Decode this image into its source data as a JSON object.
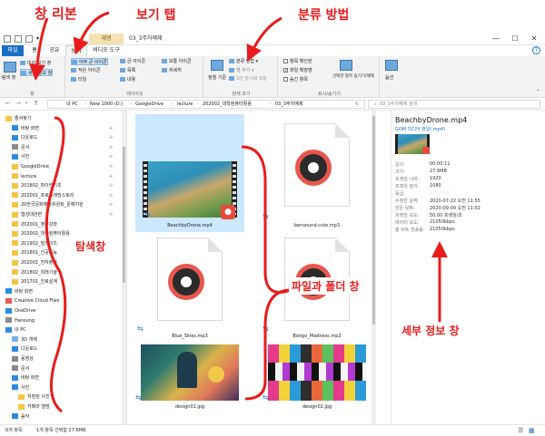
{
  "annotations": {
    "ribbon": "창 리본",
    "view_tab": "보기 탭",
    "sort_method": "분류 방법",
    "nav_pane": "탐색창",
    "file_pane": "파일과 폴더 창",
    "details_pane": "세부 정보 창"
  },
  "titlebar": {
    "tool_tab": "재생",
    "title": "03_3주차예제",
    "minimize": "—",
    "maximize": "☐",
    "close": "✕"
  },
  "tabs": {
    "file": "파일",
    "home": "홈",
    "share": "공유",
    "view": "보기",
    "video_tools": "비디오 도구",
    "help": "?"
  },
  "ribbon": {
    "pane": {
      "nav_pane": "탐색 창",
      "preview_pane": "미리 보기 창",
      "details_pane": "세부 정보 창",
      "label": "창"
    },
    "layout": {
      "extra_large": "아주 큰 아이콘",
      "large": "큰 아이콘",
      "medium": "보통 아이콘",
      "small": "작은 아이콘",
      "list": "목록",
      "details": "자세히",
      "tiles": "타일",
      "content": "내용",
      "label": "레이아웃"
    },
    "current_view": {
      "sort_by": "정렬 기준",
      "group_by": "분류 방법",
      "add_columns": "열 추가",
      "size_columns": "모든 열 너비 조정",
      "label": "현재 보기"
    },
    "show_hide": {
      "item_checkboxes": "항목 확인란",
      "file_extensions": "파일 확장명",
      "hidden_items": "숨긴 항목",
      "hide_selected": "선택한 항목 숨기기/해제",
      "label": "표시/숨기기"
    },
    "options": "옵션"
  },
  "address": {
    "crumbs": [
      "내 PC",
      "New 1000 (D:)",
      "GoogleDrive",
      "lecture",
      "202002_대학컴퓨터활용",
      "03_3주차예제"
    ],
    "search_placeholder": "03_3주차예제 검색"
  },
  "nav": {
    "items": [
      {
        "label": "즐겨찾기",
        "pinned": false
      },
      {
        "label": "바탕 화면",
        "pinned": true
      },
      {
        "label": "다운로드",
        "pinned": true
      },
      {
        "label": "문서",
        "pinned": true
      },
      {
        "label": "사진",
        "pinned": true
      },
      {
        "label": "GoogleDrive",
        "pinned": true
      },
      {
        "label": "lecture",
        "pinned": true
      },
      {
        "label": "201802_파이썬기초",
        "pinned": true
      },
      {
        "label": "202001_프로그래밍스토리",
        "pinned": true
      },
      {
        "label": "20한국문화예술위원회_문예지원",
        "pinned": true
      },
      {
        "label": "협성대관련",
        "pinned": true
      },
      {
        "label": "202001_영상강좌",
        "pinned": false
      },
      {
        "label": "202002_대학컴퓨터활용",
        "pinned": false
      },
      {
        "label": "201902_빌게이츠",
        "pinned": false
      },
      {
        "label": "201801_인공지능",
        "pinned": false
      },
      {
        "label": "202001_전자출판",
        "pinned": false
      },
      {
        "label": "201802_미래기술",
        "pinned": false
      },
      {
        "label": "201701_진로설계",
        "pinned": false
      },
      {
        "label": "바탕 화면",
        "pinned": false
      },
      {
        "label": "Creative Cloud Files",
        "pinned": false
      },
      {
        "label": "OneDrive",
        "pinned": false
      },
      {
        "label": "Hansung",
        "pinned": false
      },
      {
        "label": "내 PC",
        "pinned": false
      },
      {
        "label": "3D 개체",
        "pinned": false
      },
      {
        "label": "다운로드",
        "pinned": false
      },
      {
        "label": "동영상",
        "pinned": false
      },
      {
        "label": "문서",
        "pinned": false
      },
      {
        "label": "바탕 화면",
        "pinned": false
      },
      {
        "label": "사진",
        "pinned": false
      },
      {
        "label": "저장된 사진",
        "pinned": false
      },
      {
        "label": "카메라 앨범",
        "pinned": false
      },
      {
        "label": "음악",
        "pinned": false
      }
    ]
  },
  "files": [
    {
      "name": "BeachbyDrone.mp4",
      "kind": "video"
    },
    {
      "name": "bensound-cute.mp3",
      "kind": "audio"
    },
    {
      "name": "Blue_Skies.mp3",
      "kind": "audio"
    },
    {
      "name": "Bongo_Madness.mp3",
      "kind": "audio"
    },
    {
      "name": "design01.jpg",
      "kind": "image"
    },
    {
      "name": "design02.jpg",
      "kind": "image"
    }
  ],
  "details": {
    "filename": "BeachbyDrone.mp4",
    "type": "GOM 미디어 파일(.mp4)",
    "rows": [
      {
        "label": "길이:",
        "value": "00:00:11"
      },
      {
        "label": "크기:",
        "value": "27.6MB"
      },
      {
        "label": "프레임 너비:",
        "value": "1920"
      },
      {
        "label": "프레임 높이:",
        "value": "1080"
      },
      {
        "label": "등급:",
        "value": "☆☆☆☆☆"
      },
      {
        "label": "수정한 날짜:",
        "value": "2020-07-22 오전 11:55"
      },
      {
        "label": "만든 날짜:",
        "value": "2020-09-09 오전 11:02"
      },
      {
        "label": "프레임 속도:",
        "value": "50.00 프레임/초"
      },
      {
        "label": "데이터 속도:",
        "value": "21050kbps"
      },
      {
        "label": "총 비트 전송률:",
        "value": "21050kbps"
      }
    ]
  },
  "status": {
    "count": "6개 항목",
    "selected": "1개 항목 선택함 27.6MB"
  },
  "colors": {
    "accent": "#1a6fc4",
    "selection": "#cce8ff",
    "annotation": "#e81c1c"
  }
}
